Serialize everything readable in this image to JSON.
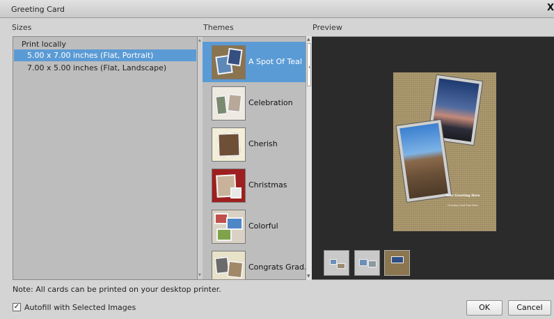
{
  "window": {
    "title": "Greeting Card",
    "close_glyph": "X"
  },
  "sizes": {
    "label": "Sizes",
    "group": "Print locally",
    "items": [
      {
        "label": "5.00 x 7.00 inches (Flat, Portrait)",
        "selected": true
      },
      {
        "label": "7.00 x 5.00 inches (Flat, Landscape)",
        "selected": false
      }
    ]
  },
  "themes": {
    "label": "Themes",
    "items": [
      {
        "label": "A Spot Of Teal",
        "selected": true
      },
      {
        "label": "Celebration",
        "selected": false
      },
      {
        "label": "Cherish",
        "selected": false
      },
      {
        "label": "Christmas",
        "selected": false
      },
      {
        "label": "Colorful",
        "selected": false
      },
      {
        "label": "Congrats Grad...",
        "selected": false
      }
    ]
  },
  "preview": {
    "label": "Preview",
    "greeting": "Your Greeting Here",
    "greeting_sub": "Greeting Card Text Here"
  },
  "footer": {
    "note": "Note: All cards can be printed on your desktop printer.",
    "autofill_label": "Autofill with Selected Images",
    "autofill_checked": true,
    "check_glyph": "✓",
    "ok_label": "OK",
    "cancel_label": "Cancel"
  },
  "colors": {
    "selection": "#5b9bd5",
    "preview_bg": "#2b2b2b",
    "panel_bg": "#bdbdbd"
  }
}
